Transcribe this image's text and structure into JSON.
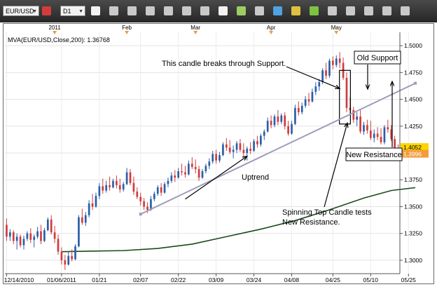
{
  "toolbar": {
    "symbol": "EUR/USD",
    "timeframe": "D1",
    "tools": [
      {
        "name": "cursor-icon",
        "color": "#f2f2f2"
      },
      {
        "name": "bar-chart-icon",
        "color": "#c9c9c9"
      },
      {
        "name": "candlestick-icon",
        "color": "#c9c9c9"
      },
      {
        "name": "line-chart-icon",
        "color": "#c9c9c9"
      },
      {
        "name": "zoom-in-icon",
        "color": "#c9c9c9"
      },
      {
        "name": "zoom-out-icon",
        "color": "#c9c9c9"
      },
      {
        "name": "scroll-icon",
        "color": "#c9c9c9"
      },
      {
        "name": "crosshair-icon",
        "color": "#f2f2f2"
      },
      {
        "name": "indicator-icon",
        "color": "#9ccc65"
      },
      {
        "name": "comment-icon",
        "color": "#c9c9c9"
      },
      {
        "name": "globe-icon",
        "color": "#4fa3e0"
      },
      {
        "name": "pencil-icon",
        "color": "#e0c040"
      },
      {
        "name": "trendline-icon",
        "color": "#7dc242"
      },
      {
        "name": "channel-icon",
        "color": "#c9c9c9"
      },
      {
        "name": "fibonacci-icon",
        "color": "#c9c9c9"
      },
      {
        "name": "gann-icon",
        "color": "#c9c9c9"
      },
      {
        "name": "draw-icon",
        "color": "#c9c9c9"
      },
      {
        "name": "text-icon",
        "color": "#c9c9c9"
      }
    ]
  },
  "chart_data": {
    "type": "candlestick",
    "indicator_label": "MVA(EUR/USD,Close,200): 1.36768",
    "y_ticks": [
      "1.5000",
      "1.4750",
      "1.4500",
      "1.4250",
      "1.4000",
      "1.3750",
      "1.3500",
      "1.3250",
      "1.3000"
    ],
    "ylim": [
      1.2875,
      1.5125
    ],
    "current_price": "1.4052",
    "bid_price": "1.3996",
    "month_labels": [
      "2011",
      "Feb",
      "Mar",
      "Apr",
      "May"
    ],
    "month_marker_index": [
      14,
      35,
      55,
      77,
      96
    ],
    "x_ticks": [
      "12/14/2010",
      "01/06/2011",
      "01/21",
      "02/07",
      "02/22",
      "03/09",
      "03/24",
      "04/08",
      "04/25",
      "05/10",
      "05/25"
    ],
    "x_tick_index": [
      0,
      16,
      27,
      39,
      50,
      61,
      72,
      83,
      95,
      106,
      117
    ],
    "grid": true,
    "candles": [
      [
        1.333,
        1.339,
        1.318,
        1.322
      ],
      [
        1.322,
        1.329,
        1.318,
        1.326
      ],
      [
        1.326,
        1.328,
        1.315,
        1.318
      ],
      [
        1.318,
        1.325,
        1.31,
        1.322
      ],
      [
        1.322,
        1.324,
        1.312,
        1.314
      ],
      [
        1.314,
        1.323,
        1.31,
        1.32
      ],
      [
        1.32,
        1.327,
        1.318,
        1.325
      ],
      [
        1.325,
        1.33,
        1.316,
        1.319
      ],
      [
        1.319,
        1.324,
        1.312,
        1.322
      ],
      [
        1.322,
        1.331,
        1.32,
        1.327
      ],
      [
        1.327,
        1.333,
        1.315,
        1.318
      ],
      [
        1.318,
        1.33,
        1.317,
        1.328
      ],
      [
        1.328,
        1.34,
        1.327,
        1.338
      ],
      [
        1.338,
        1.342,
        1.324,
        1.326
      ],
      [
        1.326,
        1.332,
        1.316,
        1.32
      ],
      [
        1.32,
        1.324,
        1.305,
        1.308
      ],
      [
        1.308,
        1.312,
        1.296,
        1.3
      ],
      [
        1.3,
        1.305,
        1.291,
        1.296
      ],
      [
        1.296,
        1.308,
        1.295,
        1.304
      ],
      [
        1.304,
        1.31,
        1.299,
        1.301
      ],
      [
        1.301,
        1.315,
        1.3,
        1.313
      ],
      [
        1.313,
        1.342,
        1.312,
        1.34
      ],
      [
        1.34,
        1.348,
        1.333,
        1.335
      ],
      [
        1.335,
        1.345,
        1.332,
        1.342
      ],
      [
        1.342,
        1.356,
        1.34,
        1.353
      ],
      [
        1.353,
        1.362,
        1.347,
        1.35
      ],
      [
        1.35,
        1.363,
        1.349,
        1.36
      ],
      [
        1.36,
        1.372,
        1.357,
        1.369
      ],
      [
        1.369,
        1.376,
        1.362,
        1.365
      ],
      [
        1.365,
        1.374,
        1.363,
        1.37
      ],
      [
        1.37,
        1.378,
        1.365,
        1.368
      ],
      [
        1.368,
        1.376,
        1.367,
        1.374
      ],
      [
        1.374,
        1.379,
        1.367,
        1.37
      ],
      [
        1.37,
        1.376,
        1.363,
        1.366
      ],
      [
        1.366,
        1.373,
        1.364,
        1.371
      ],
      [
        1.371,
        1.386,
        1.37,
        1.382
      ],
      [
        1.382,
        1.385,
        1.37,
        1.372
      ],
      [
        1.372,
        1.378,
        1.361,
        1.364
      ],
      [
        1.364,
        1.368,
        1.357,
        1.359
      ],
      [
        1.359,
        1.363,
        1.351,
        1.355
      ],
      [
        1.355,
        1.358,
        1.347,
        1.35
      ],
      [
        1.35,
        1.354,
        1.344,
        1.347
      ],
      [
        1.347,
        1.36,
        1.346,
        1.357
      ],
      [
        1.357,
        1.364,
        1.355,
        1.362
      ],
      [
        1.362,
        1.37,
        1.36,
        1.368
      ],
      [
        1.368,
        1.372,
        1.36,
        1.363
      ],
      [
        1.363,
        1.373,
        1.362,
        1.371
      ],
      [
        1.371,
        1.377,
        1.368,
        1.374
      ],
      [
        1.374,
        1.382,
        1.372,
        1.379
      ],
      [
        1.379,
        1.384,
        1.373,
        1.377
      ],
      [
        1.377,
        1.386,
        1.376,
        1.383
      ],
      [
        1.383,
        1.39,
        1.379,
        1.382
      ],
      [
        1.382,
        1.388,
        1.377,
        1.38
      ],
      [
        1.38,
        1.393,
        1.379,
        1.39
      ],
      [
        1.39,
        1.396,
        1.385,
        1.387
      ],
      [
        1.387,
        1.394,
        1.381,
        1.385
      ],
      [
        1.385,
        1.388,
        1.374,
        1.377
      ],
      [
        1.377,
        1.385,
        1.376,
        1.383
      ],
      [
        1.383,
        1.39,
        1.381,
        1.388
      ],
      [
        1.388,
        1.395,
        1.385,
        1.392
      ],
      [
        1.392,
        1.402,
        1.39,
        1.399
      ],
      [
        1.399,
        1.403,
        1.39,
        1.393
      ],
      [
        1.393,
        1.401,
        1.391,
        1.398
      ],
      [
        1.398,
        1.41,
        1.397,
        1.408
      ],
      [
        1.408,
        1.414,
        1.402,
        1.405
      ],
      [
        1.405,
        1.412,
        1.399,
        1.401
      ],
      [
        1.401,
        1.407,
        1.395,
        1.403
      ],
      [
        1.403,
        1.411,
        1.4,
        1.409
      ],
      [
        1.409,
        1.413,
        1.401,
        1.403
      ],
      [
        1.403,
        1.409,
        1.396,
        1.4
      ],
      [
        1.4,
        1.406,
        1.393,
        1.404
      ],
      [
        1.404,
        1.41,
        1.399,
        1.402
      ],
      [
        1.402,
        1.413,
        1.401,
        1.411
      ],
      [
        1.411,
        1.416,
        1.405,
        1.408
      ],
      [
        1.408,
        1.418,
        1.406,
        1.416
      ],
      [
        1.416,
        1.422,
        1.412,
        1.42
      ],
      [
        1.42,
        1.433,
        1.419,
        1.43
      ],
      [
        1.43,
        1.435,
        1.423,
        1.426
      ],
      [
        1.426,
        1.436,
        1.424,
        1.434
      ],
      [
        1.434,
        1.44,
        1.426,
        1.429
      ],
      [
        1.429,
        1.437,
        1.427,
        1.435
      ],
      [
        1.435,
        1.438,
        1.422,
        1.425
      ],
      [
        1.425,
        1.43,
        1.416,
        1.418
      ],
      [
        1.418,
        1.43,
        1.417,
        1.427
      ],
      [
        1.427,
        1.445,
        1.426,
        1.442
      ],
      [
        1.442,
        1.448,
        1.435,
        1.438
      ],
      [
        1.438,
        1.447,
        1.436,
        1.444
      ],
      [
        1.444,
        1.453,
        1.442,
        1.45
      ],
      [
        1.45,
        1.456,
        1.444,
        1.448
      ],
      [
        1.448,
        1.46,
        1.447,
        1.457
      ],
      [
        1.457,
        1.466,
        1.454,
        1.462
      ],
      [
        1.462,
        1.469,
        1.458,
        1.466
      ],
      [
        1.466,
        1.479,
        1.464,
        1.477
      ],
      [
        1.477,
        1.484,
        1.469,
        1.472
      ],
      [
        1.472,
        1.488,
        1.47,
        1.486
      ],
      [
        1.486,
        1.49,
        1.478,
        1.482
      ],
      [
        1.482,
        1.491,
        1.48,
        1.488
      ],
      [
        1.488,
        1.494,
        1.479,
        1.484
      ],
      [
        1.484,
        1.489,
        1.468,
        1.47
      ],
      [
        1.47,
        1.475,
        1.438,
        1.442
      ],
      [
        1.442,
        1.452,
        1.435,
        1.44
      ],
      [
        1.44,
        1.443,
        1.428,
        1.431
      ],
      [
        1.431,
        1.438,
        1.425,
        1.434
      ],
      [
        1.434,
        1.44,
        1.418,
        1.42
      ],
      [
        1.42,
        1.429,
        1.417,
        1.426
      ],
      [
        1.426,
        1.431,
        1.418,
        1.421
      ],
      [
        1.421,
        1.43,
        1.412,
        1.414
      ],
      [
        1.414,
        1.422,
        1.41,
        1.418
      ],
      [
        1.418,
        1.424,
        1.412,
        1.415
      ],
      [
        1.415,
        1.423,
        1.408,
        1.41
      ],
      [
        1.41,
        1.426,
        1.408,
        1.424
      ],
      [
        1.424,
        1.431,
        1.419,
        1.422
      ],
      [
        1.422,
        1.426,
        1.411,
        1.413
      ],
      [
        1.413,
        1.416,
        1.401,
        1.404
      ],
      [
        1.404,
        1.408,
        1.397,
        1.3996
      ]
    ],
    "mva_200": [
      [
        16,
        1.308
      ],
      [
        24,
        1.3085
      ],
      [
        34,
        1.309
      ],
      [
        44,
        1.311
      ],
      [
        54,
        1.315
      ],
      [
        64,
        1.322
      ],
      [
        74,
        1.329
      ],
      [
        84,
        1.337
      ],
      [
        94,
        1.347
      ],
      [
        104,
        1.358
      ],
      [
        112,
        1.365
      ],
      [
        119,
        1.3677
      ]
    ],
    "support_line": {
      "from": [
        39,
        1.343
      ],
      "to": [
        119,
        1.465
      ]
    },
    "uptrend_arrow": {
      "from": [
        52,
        1.357
      ],
      "to": [
        70,
        1.397
      ]
    },
    "annotations": {
      "breaks_support": "This candle breaks through Support.",
      "old_support": "Old Support",
      "uptrend": "Uptrend",
      "spinning_top": "Spinning Top Candle tests New Resistance.",
      "new_resistance": "New Resistance"
    },
    "colors": {
      "bull": "#2a5fa8",
      "bear": "#d23b3b",
      "mva": "#1a4a1a",
      "support": "#9c9cbc",
      "current_price_bg": "#ffd400",
      "bid_price_bg": "#f39c3c"
    }
  }
}
